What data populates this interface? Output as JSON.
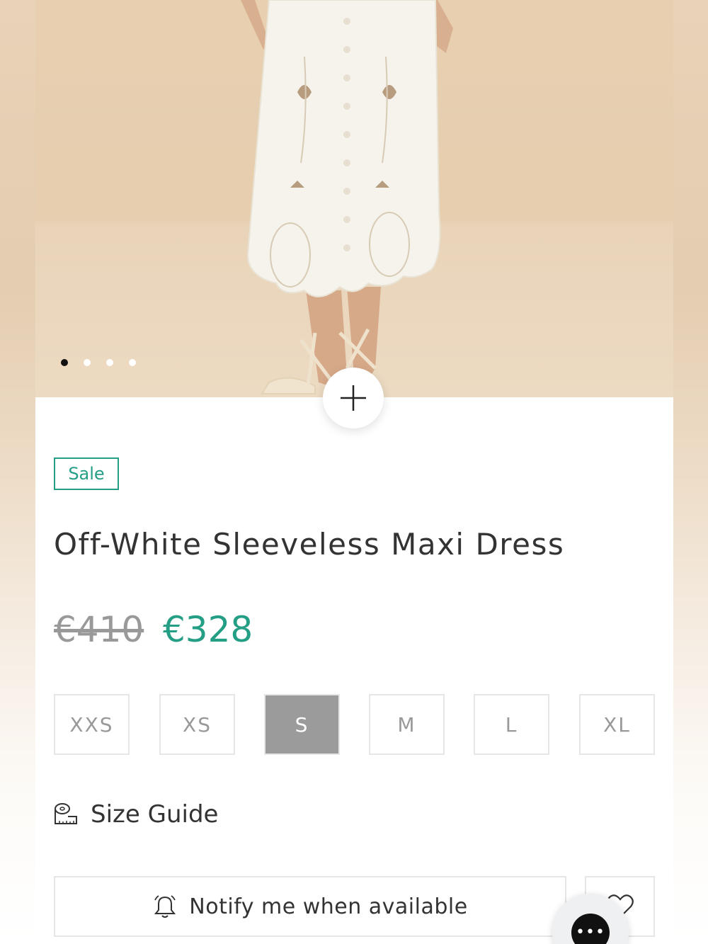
{
  "product": {
    "badge": "Sale",
    "title": "Off-White Sleeveless Maxi Dress",
    "old_price": "€410",
    "new_price": "€328",
    "zoom_label": "+",
    "image_count": 4,
    "active_image_index": 0
  },
  "sizes": {
    "options": [
      "XXS",
      "XS",
      "S",
      "M",
      "L",
      "XL"
    ],
    "selected": "S"
  },
  "size_guide": {
    "label": "Size Guide",
    "icon": "measuring-tape-icon"
  },
  "actions": {
    "notify_label": "Notify me when available",
    "notify_icon": "bell-icon",
    "wishlist_icon": "heart-icon",
    "chat_icon": "chat-ellipsis-icon",
    "chat_label": "•••"
  },
  "colors": {
    "accent": "#249e84",
    "selected_size_bg": "#9b9b9b",
    "border": "#e6e6e6"
  }
}
